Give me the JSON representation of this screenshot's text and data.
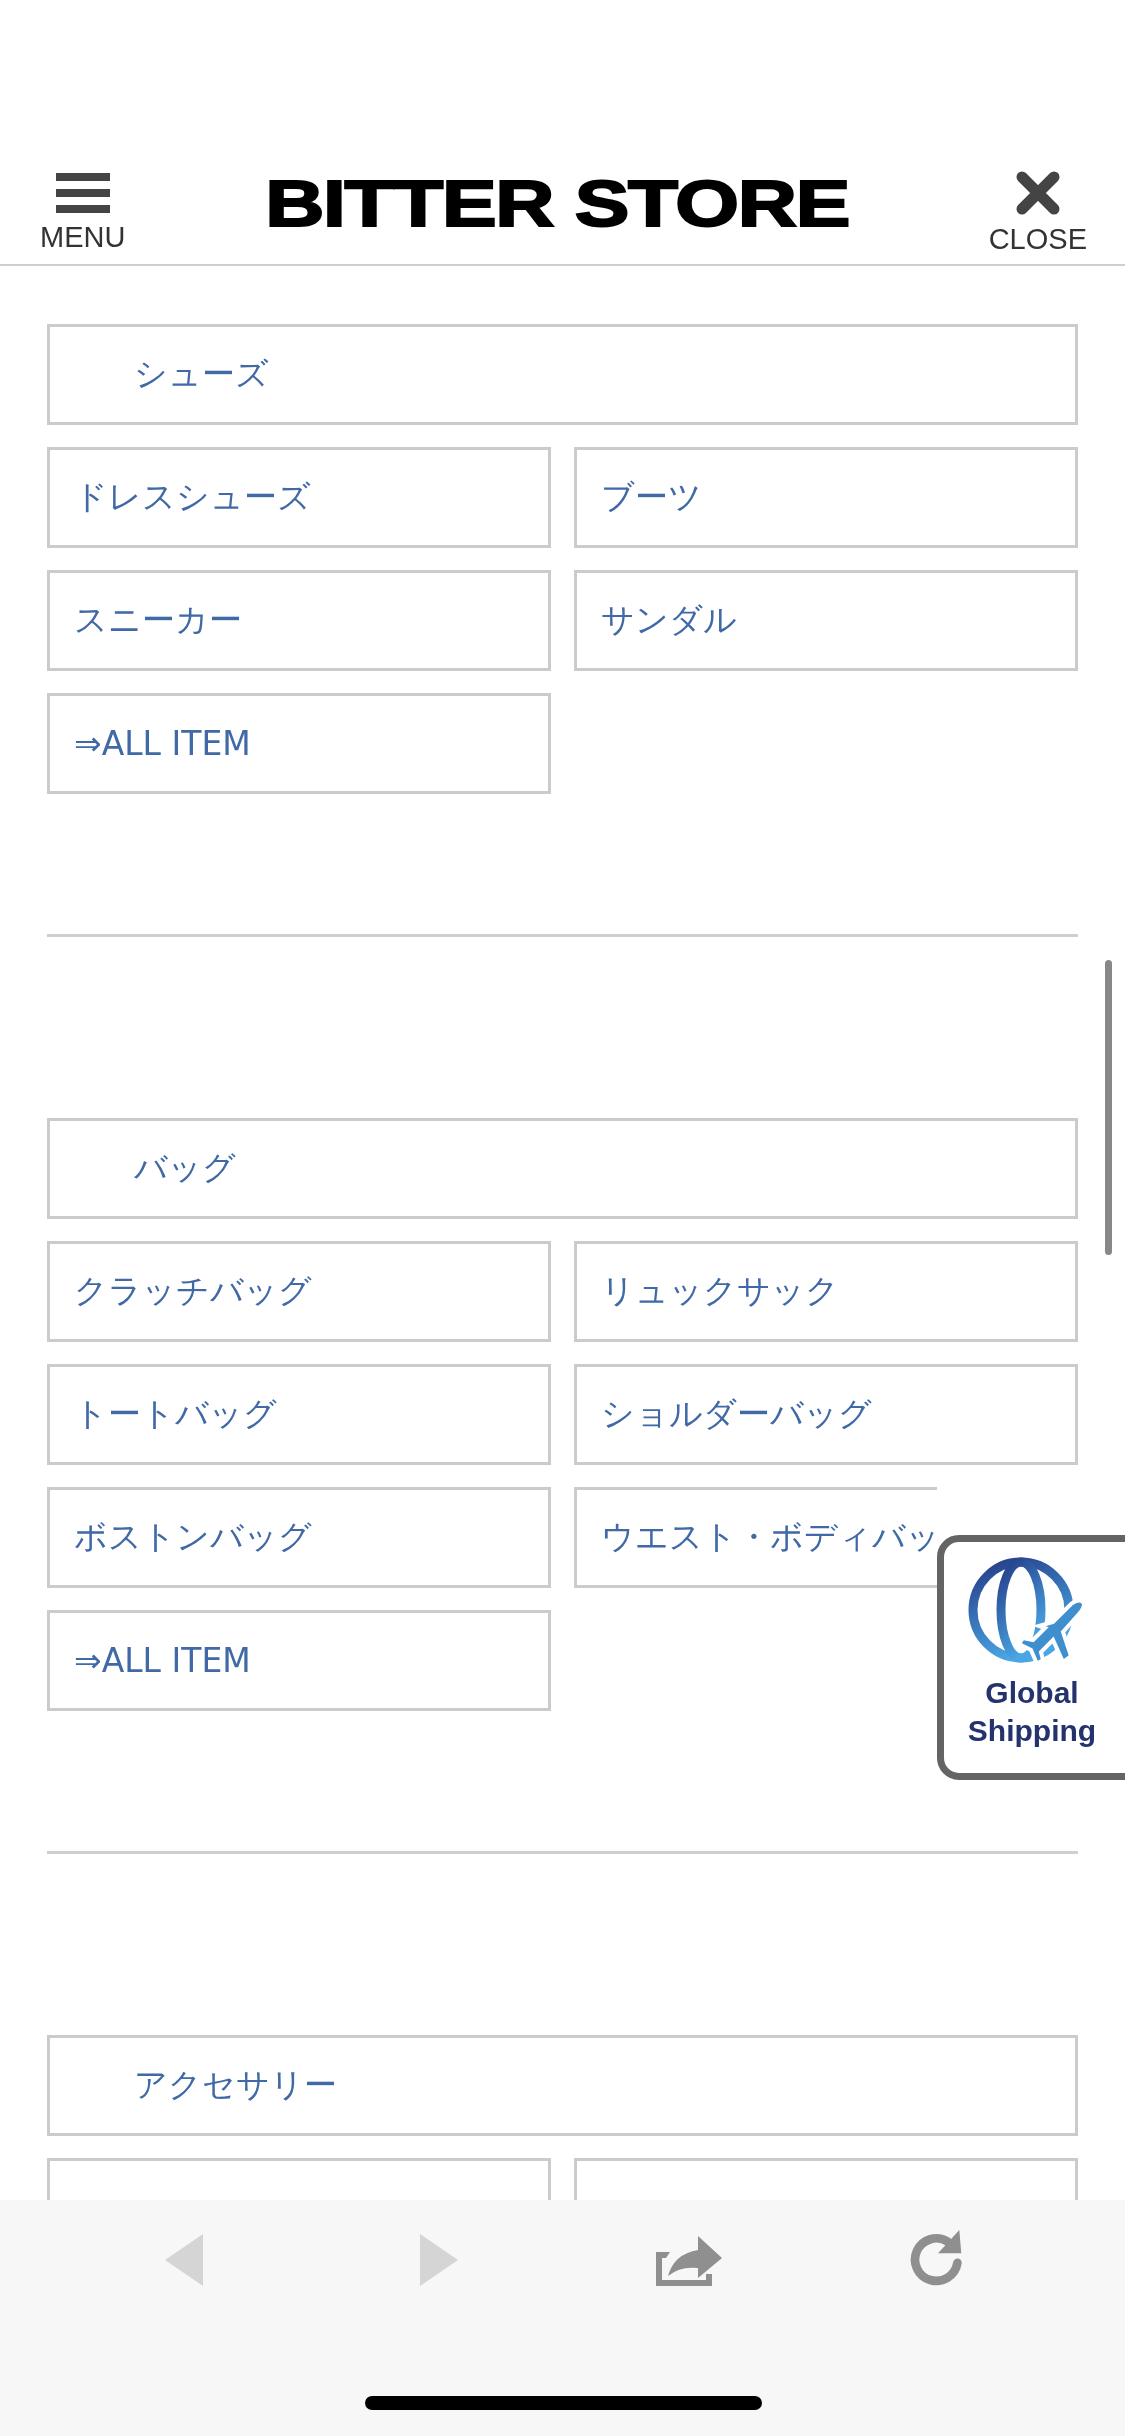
{
  "header": {
    "menu_label": "MENU",
    "logo": "BITTER STORE",
    "close_label": "CLOSE"
  },
  "sections": [
    {
      "heading": "シューズ",
      "items": [
        {
          "kind": "link",
          "label": "ドレスシューズ"
        },
        {
          "kind": "link",
          "label": "ブーツ"
        },
        {
          "kind": "link",
          "label": "スニーカー"
        },
        {
          "kind": "link",
          "label": "サンダル"
        },
        {
          "kind": "link",
          "label": "⇒ALL ITEM"
        }
      ]
    },
    {
      "heading": "バッグ",
      "items": [
        {
          "kind": "link",
          "label": "クラッチバッグ"
        },
        {
          "kind": "link",
          "label": "リュックサック"
        },
        {
          "kind": "link",
          "label": "トートバッグ"
        },
        {
          "kind": "link",
          "label": "ショルダーバッグ"
        },
        {
          "kind": "link",
          "label": "ボストンバッグ"
        },
        {
          "kind": "covered",
          "label": "ウエスト・ボディバッ"
        },
        {
          "kind": "link",
          "label": "⇒ALL ITEM"
        }
      ]
    },
    {
      "heading": "アクセサリー",
      "items": [
        {
          "kind": "cut"
        },
        {
          "kind": "cut"
        }
      ]
    }
  ],
  "badge": {
    "lines": [
      "Global",
      "Shipping"
    ]
  },
  "toolbar": [
    {
      "kind": "back",
      "disabled": true
    },
    {
      "kind": "forward",
      "disabled": true
    },
    {
      "kind": "share",
      "disabled": false
    },
    {
      "kind": "reload",
      "disabled": false
    }
  ]
}
